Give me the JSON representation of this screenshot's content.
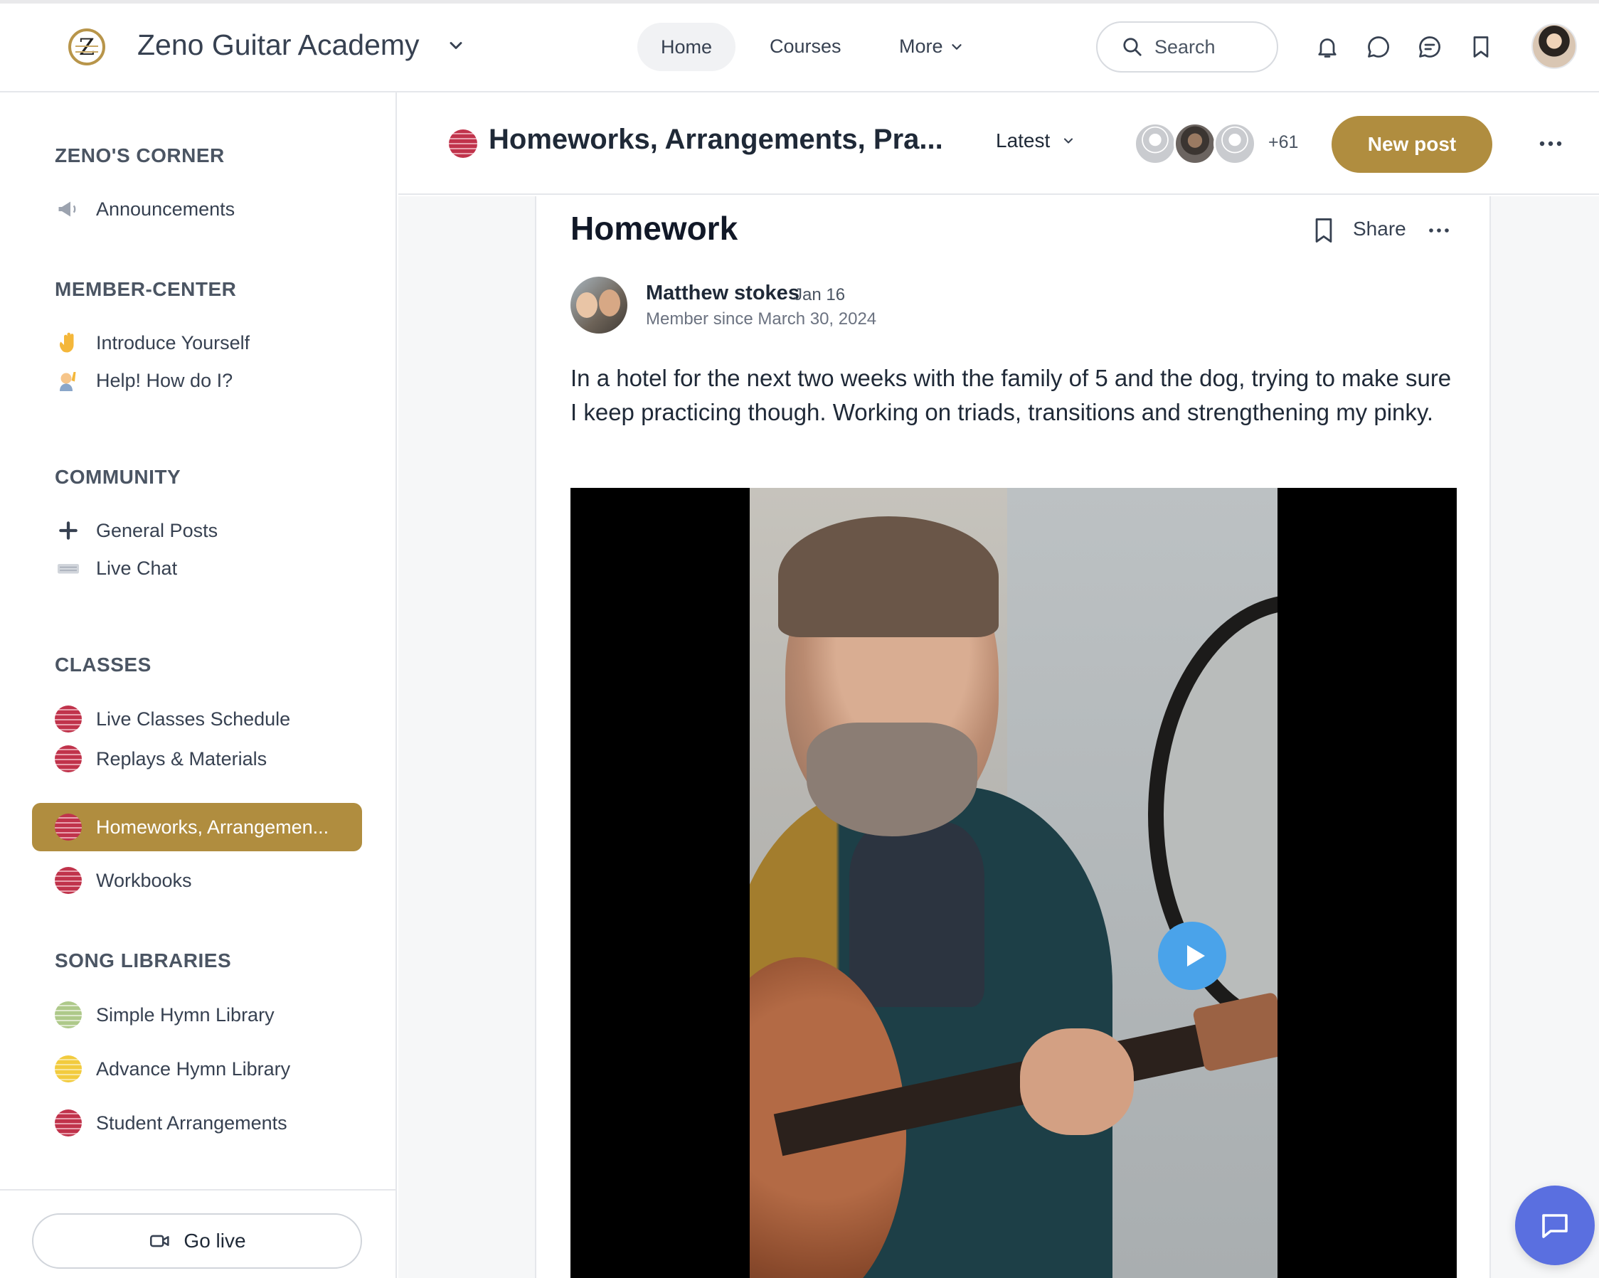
{
  "app": {
    "title": "Zeno Guitar Academy",
    "logo_letter": "Z",
    "brand_color": "#b08d3f"
  },
  "nav": {
    "home": "Home",
    "courses": "Courses",
    "more": "More"
  },
  "search": {
    "label": "Search"
  },
  "header_icons": [
    "bell-icon",
    "chat-bubble-icon",
    "messages-icon",
    "bookmark-icon"
  ],
  "sidebar": {
    "sections": [
      {
        "title": "ZENO'S CORNER",
        "items": [
          {
            "label": "Announcements",
            "icon": "megaphone-icon"
          }
        ]
      },
      {
        "title": "MEMBER-CENTER",
        "items": [
          {
            "label": "Introduce Yourself",
            "icon": "waving-hand-icon"
          },
          {
            "label": "Help! How do I?",
            "icon": "raising-hand-icon"
          }
        ]
      },
      {
        "title": "COMMUNITY",
        "items": [
          {
            "label": "General Posts",
            "icon": "plus-icon"
          },
          {
            "label": "Live Chat",
            "icon": "keyboard-icon"
          }
        ]
      },
      {
        "title": "CLASSES",
        "items": [
          {
            "label": "Live Classes Schedule",
            "icon": "red-dot-icon"
          },
          {
            "label": "Replays & Materials",
            "icon": "red-dot-icon"
          },
          {
            "label": "Homeworks, Arrangemen...",
            "icon": "red-dot-icon",
            "active": true
          },
          {
            "label": "Workbooks",
            "icon": "red-dot-icon"
          }
        ]
      },
      {
        "title": "SONG LIBRARIES",
        "items": [
          {
            "label": "Simple Hymn Library",
            "icon": "green-dot-icon"
          },
          {
            "label": "Advance Hymn Library",
            "icon": "yellow-dot-icon"
          },
          {
            "label": "Student Arrangements",
            "icon": "red-dot-icon"
          }
        ]
      }
    ],
    "go_live": "Go live"
  },
  "space": {
    "title": "Homeworks, Arrangements, Pra...",
    "sort": "Latest",
    "member_count": "+61",
    "new_post": "New post"
  },
  "post": {
    "title": "Homework",
    "share": "Share",
    "author": "Matthew stokes",
    "date": "Jan 16",
    "member_since": "Member since March 30, 2024",
    "body": "In a hotel for the next two weeks with the family of 5 and the dog, trying to make sure I keep practicing though. Working on triads, transitions and strengthening my pinky."
  }
}
